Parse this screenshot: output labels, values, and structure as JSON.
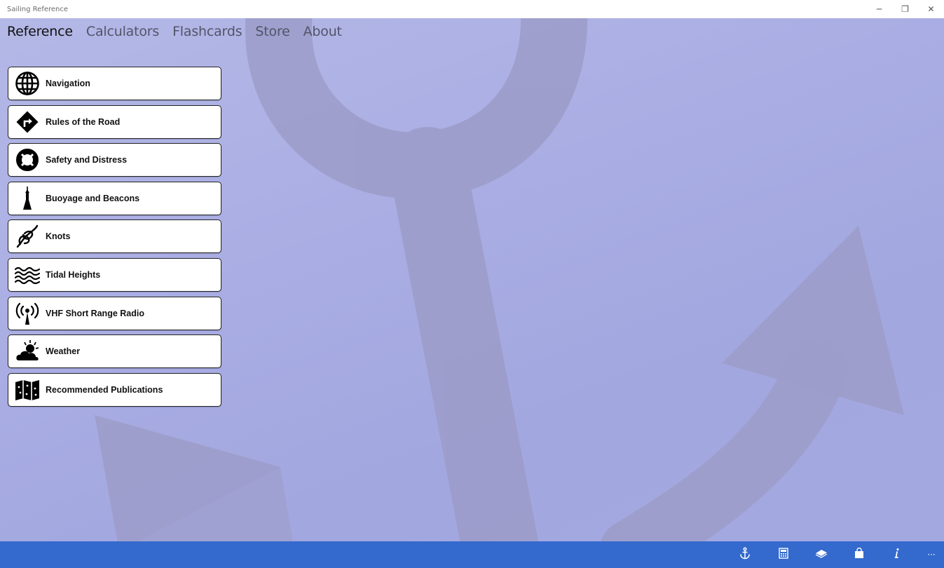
{
  "window": {
    "title": "Sailing Reference",
    "minimize_glyph": "─",
    "restore_glyph": "❐",
    "close_glyph": "✕"
  },
  "pivot": {
    "tabs": [
      {
        "label": "Reference",
        "active": true
      },
      {
        "label": "Calculators",
        "active": false
      },
      {
        "label": "Flashcards",
        "active": false
      },
      {
        "label": "Store",
        "active": false
      },
      {
        "label": "About",
        "active": false
      }
    ]
  },
  "reference_list": {
    "items": [
      {
        "label": "Navigation",
        "icon": "globe-icon"
      },
      {
        "label": "Rules of the Road",
        "icon": "turn-sign-icon"
      },
      {
        "label": "Safety and Distress",
        "icon": "lifebuoy-icon"
      },
      {
        "label": "Buoyage and Beacons",
        "icon": "buoy-icon"
      },
      {
        "label": "Knots",
        "icon": "knot-icon"
      },
      {
        "label": "Tidal Heights",
        "icon": "waves-icon"
      },
      {
        "label": "VHF Short Range Radio",
        "icon": "antenna-icon"
      },
      {
        "label": "Weather",
        "icon": "sun-cloud-icon"
      },
      {
        "label": "Recommended Publications",
        "icon": "map-icon"
      }
    ]
  },
  "appbar": {
    "buttons": [
      "anchor-icon",
      "calculator-icon",
      "flashcards-icon",
      "store-bag-icon",
      "info-icon"
    ],
    "more_glyph": "···"
  },
  "colors": {
    "appbar": "#3469cd",
    "background": "#a9ade3",
    "active_tab": "#111111",
    "inactive_tab": "#535468"
  }
}
